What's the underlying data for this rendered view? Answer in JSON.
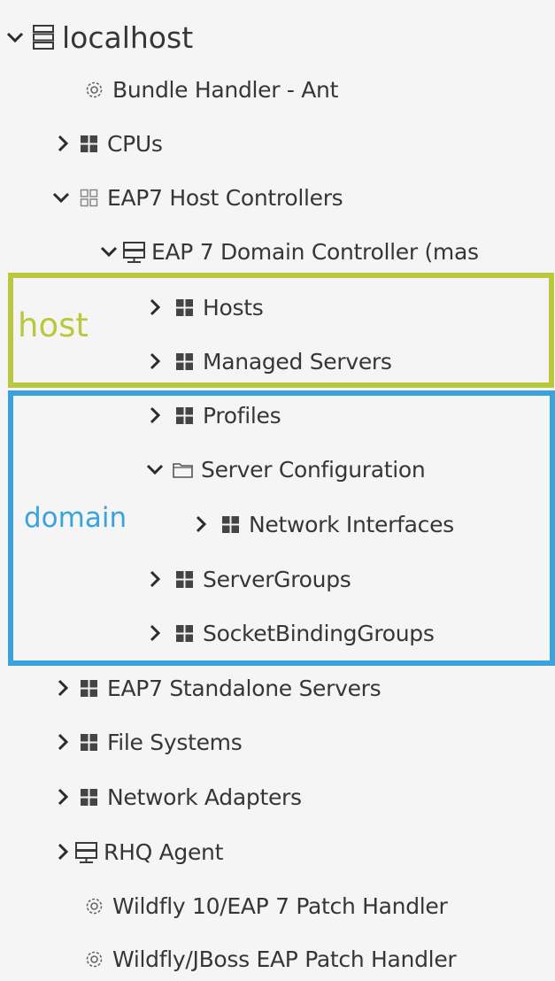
{
  "tree": {
    "root": "localhost",
    "items": [
      {
        "label": "Bundle Handler - Ant"
      },
      {
        "label": "CPUs"
      },
      {
        "label": "EAP7 Host Controllers"
      },
      {
        "label": "EAP 7 Domain Controller (mas"
      },
      {
        "label": "Hosts"
      },
      {
        "label": "Managed Servers"
      },
      {
        "label": "Profiles"
      },
      {
        "label": "Server Configuration"
      },
      {
        "label": "Network Interfaces"
      },
      {
        "label": "ServerGroups"
      },
      {
        "label": "SocketBindingGroups"
      },
      {
        "label": "EAP7 Standalone Servers"
      },
      {
        "label": "File Systems"
      },
      {
        "label": "Network Adapters"
      },
      {
        "label": "RHQ Agent"
      },
      {
        "label": "Wildfly 10/EAP 7 Patch Handler"
      },
      {
        "label": "Wildfly/JBoss EAP Patch Handler"
      }
    ]
  },
  "annotations": {
    "host_label": "host",
    "domain_label": "domain",
    "host_color": "#b9c83c",
    "domain_color": "#3aa3dc"
  }
}
